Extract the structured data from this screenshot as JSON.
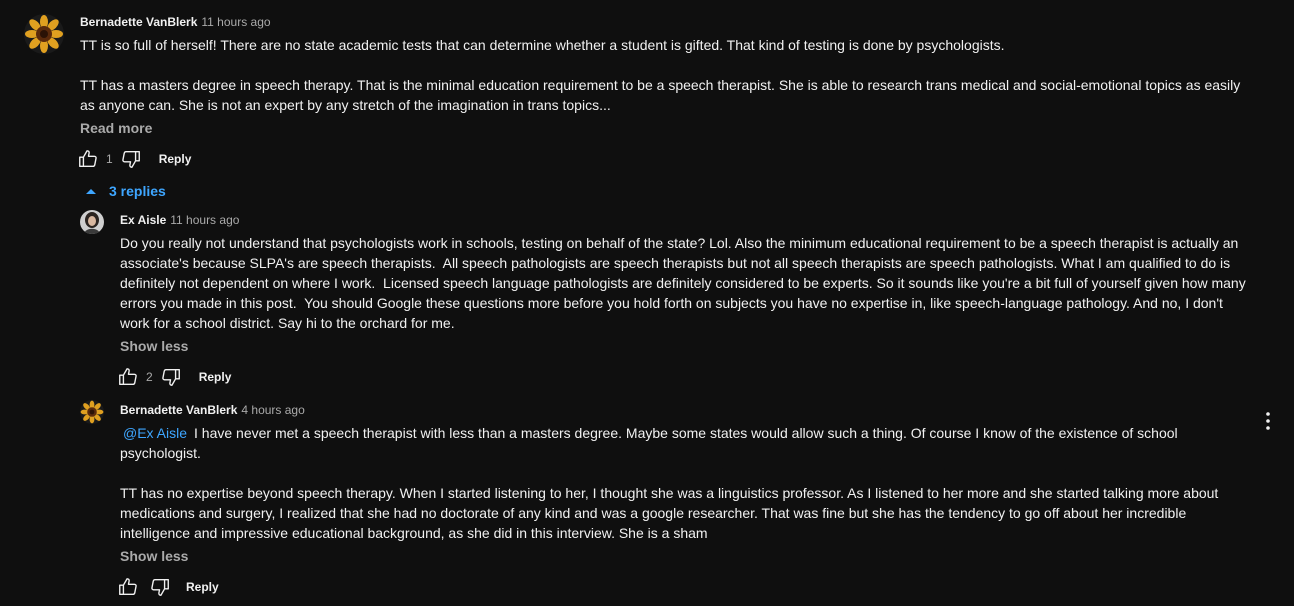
{
  "comment": {
    "author": "Bernadette VanBlerk",
    "time": "11 hours ago",
    "paragraph1": "TT is so full of herself! There are no state academic tests that can determine whether a student is gifted. That kind of testing is done by psychologists.",
    "paragraph2_line1": "TT has a masters degree in speech therapy. That is the minimal education requirement to be a speech therapist. She is able to research trans medical and social-emotional topics as easily",
    "paragraph2_line2": "as anyone can. She is not an expert by any stretch of the imagination in trans topics...",
    "read_more": "Read more",
    "likes": "1",
    "reply_label": "Reply",
    "replies_toggle": "3 replies"
  },
  "replies": [
    {
      "author": "Ex Aisle",
      "time": "11 hours ago",
      "text": "Do you really not understand that psychologists work in schools, testing on behalf of the state? Lol. Also the minimum educational requirement to be a speech therapist is actually an\nassociate's because SLPA's are speech therapists.  All speech pathologists are speech therapists but not all speech therapists are speech pathologists. What I am qualified to do is\ndefinitely not dependent on where I work.  Licensed speech language pathologists are definitely considered to be experts. So it sounds like you're a bit full of yourself given how many\nerrors you made in this post.  You should Google these questions more before you hold forth on subjects you have no expertise in, like speech-language pathology. And no, I don't\nwork for a school district. Say hi to the orchard for me.",
      "show_less": "Show less",
      "likes": "2",
      "reply_label": "Reply"
    },
    {
      "author": "Bernadette VanBlerk",
      "time": "4 hours ago",
      "mention": "@Ex Aisle",
      "text_line1": "I have never met a speech therapist with less than a masters degree. Maybe some states would allow such a thing. Of course I know of the existence of school",
      "text_rest": "psychologist.\n\nTT has no expertise beyond speech therapy. When I started listening to her, I thought she was a linguistics professor. As I listened to her more and she started talking more about\nmedications and surgery, I realized that she had no doctorate of any kind and was a google researcher. That was fine but she has the tendency to go off about her incredible\nintelligence and impressive educational background, as she did in this interview. She is a sham",
      "show_less": "Show less",
      "reply_label": "Reply"
    }
  ],
  "colors": {
    "background": "#0f0f0f",
    "text": "#f1f1f1",
    "secondary": "#aaaaaa",
    "link": "#3ea6ff"
  },
  "icons": [
    "sunflower-avatar",
    "woman-avatar",
    "thumbs-up-icon",
    "thumbs-down-icon",
    "caret-up-icon",
    "more-vert-icon"
  ]
}
